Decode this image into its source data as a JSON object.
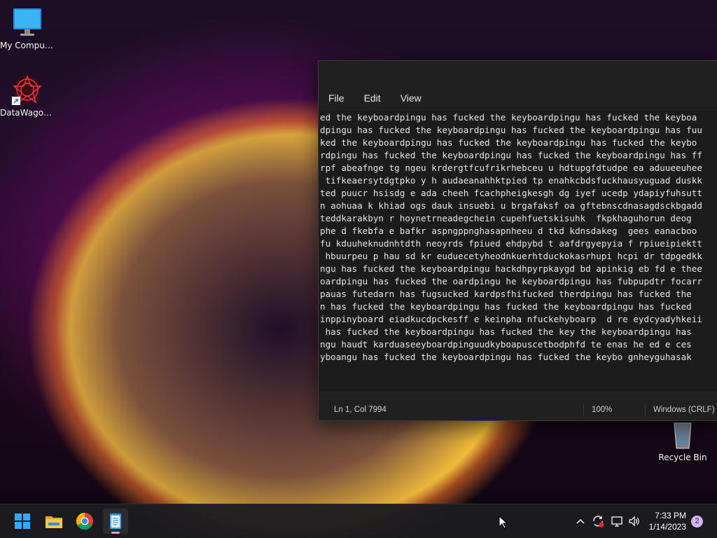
{
  "desktop": {
    "icons": [
      {
        "label": "My Computer",
        "icon": "monitor-icon"
      },
      {
        "label": "DataWagon...",
        "icon": "datawagon-app-icon"
      },
      {
        "label": "Recycle Bin",
        "icon": "recycle-bin-icon"
      }
    ]
  },
  "notepad": {
    "menu": [
      "File",
      "Edit",
      "View"
    ],
    "lines": [
      "ed the keyboardpingu has fucked the keyboardpingu has fucked the keyboa",
      "dpingu has fucked the keyboardpingu has fucked the keyboardpingu has fuu",
      "ked the keyboardpingu has fucked the keyboardpingu has fucked the keybo",
      "rdpingu has fucked the keyboardpingu has fucked the keyboardpingu has ff",
      "rpf abeafnge tg ngeu krdergtfcufrikrhebceu u hdtupgfdtudpe ea aduueeuhee",
      " tifkeaersytdgtpko y h audaeanahhktpied tp enahkcbdsfuckhausyuguad duskk",
      "ted puucr hsisdg e ada cheeh fcachpheigkesgh dg iyef ucedp ydapiyfuhsutt",
      "n aohuaa k khiad ogs dauk insuebi u brgafaksf oa gftebnscdnasagdsckbgadd",
      "teddkarakbyn r hoynetrneadegchein cupehfuetskisuhk  fkpkhaguhorun deog",
      "phe d fkebfa e bafkr aspngppnghasapnheeu d tkd kdnsdakeg  gees eanacboo",
      "fu kduuheknudnhtdth neoyrds fpiued ehdpybd t aafdrgyepyia f rpiueipiektt",
      " hbuurpeu p hau sd kr euduecetyheodnkuerhtduckokasrhupi hcpi dr tdpgedkk",
      "ngu has fucked the keyboardpingu hackdhpyrpkaygd bd apinkig eb fd e thee",
      "oardpingu has fucked the oardpingu he keyboardpingu has fubpupdtr focarr",
      "pauas futedarn has fugsucked kardpsfhifucked therdpingu has fucked the",
      "n has fucked the keyboardpingu has fucked the keyboardpingu has fucked",
      "inppinyboard eiadkucdpckesff e keinpha nfuckehyboarp  d re eydcyadyhkeii",
      " has fucked the keyboardpingu has fucked the key the keyboardpingu has",
      "ngu haudt karduaseeyboardpinguudkyboapuscetbodphfd te enas he ed e ces",
      "yboangu has fucked the keyboardpingu has fucked the keybo gnheyguhasak"
    ],
    "status": {
      "position": "Ln 1, Col 7994",
      "zoom": "100%",
      "line_ending": "Windows (CRLF)"
    }
  },
  "taskbar": {
    "apps": [
      "start-icon",
      "file-explorer-icon",
      "chrome-icon",
      "notepad-icon"
    ],
    "clock": {
      "time": "7:33 PM",
      "date": "1/14/2023"
    },
    "notification_count": "2"
  }
}
